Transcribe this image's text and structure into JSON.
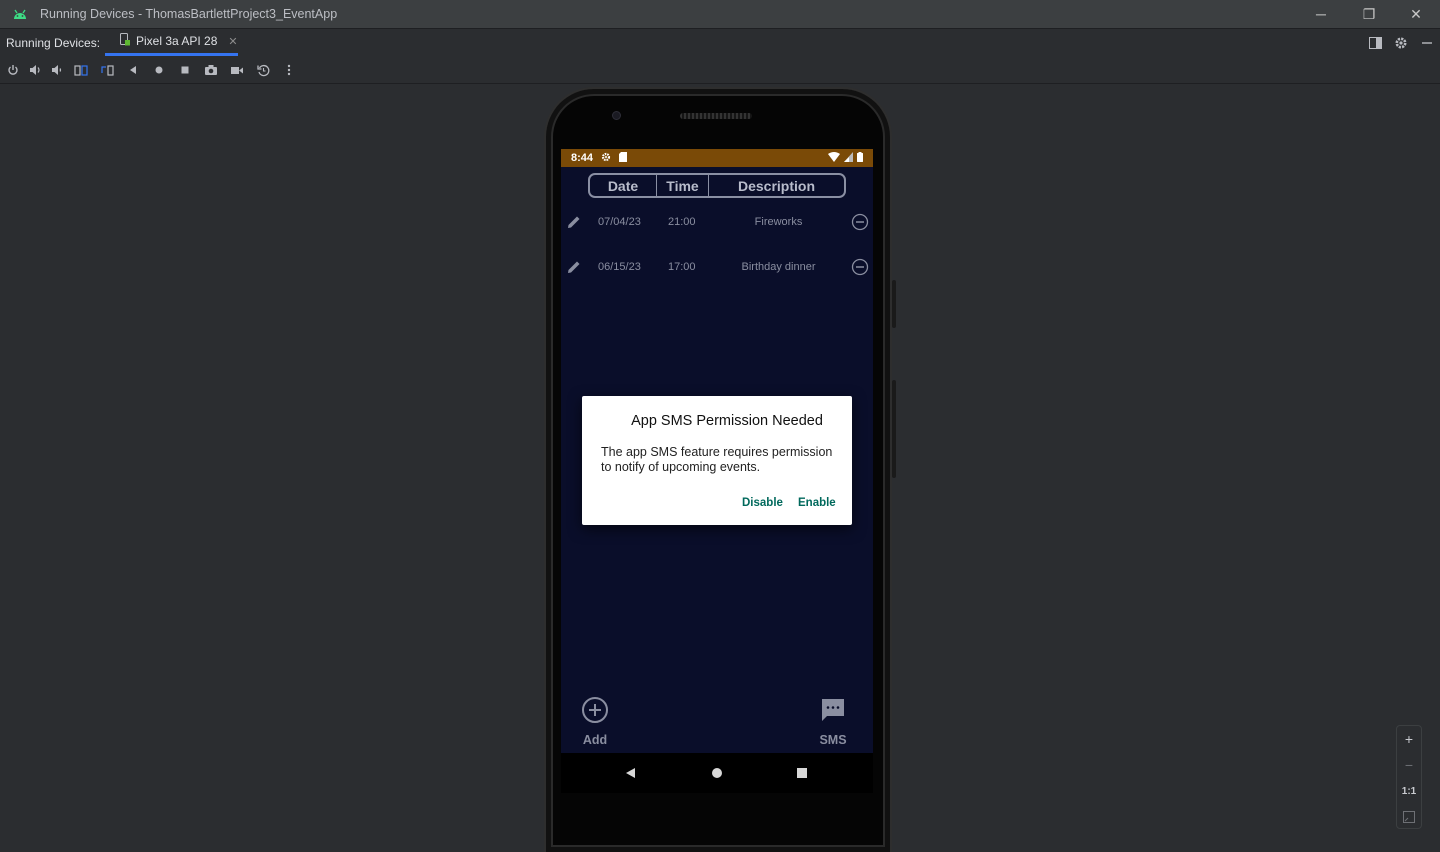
{
  "window": {
    "title": "Running Devices - ThomasBartlettProject3_EventApp",
    "minimize": "─",
    "restore": "❐",
    "close": "✕"
  },
  "tabbar": {
    "label": "Running Devices:",
    "tab_label": "Pixel 3a API 28",
    "tab_close": "✕"
  },
  "toolbar": {
    "buttons": [
      "power-icon",
      "volume-up-icon",
      "volume-down-icon",
      "rotate-left-icon",
      "rotate-right-icon",
      "back-icon",
      "home-icon",
      "overview-icon",
      "screenshot-icon",
      "screen-record-icon",
      "reset-icon",
      "more-icon"
    ]
  },
  "device": {
    "status_time": "8:44",
    "accent_color": "#7a4a07",
    "background_color": "#0a0e2a"
  },
  "table": {
    "headers": [
      "Date",
      "Time",
      "Description"
    ],
    "rows": [
      {
        "date": "07/04/23",
        "time": "21:00",
        "description": "Fireworks"
      },
      {
        "date": "06/15/23",
        "time": "17:00",
        "description": "Birthday dinner"
      }
    ]
  },
  "bottom": {
    "add_label": "Add",
    "sms_label": "SMS"
  },
  "dialog": {
    "title": "App SMS Permission Needed",
    "message": "The app SMS feature requires permission to notify of upcoming events.",
    "disable_label": "Disable",
    "enable_label": "Enable",
    "button_color": "#00695c"
  },
  "zoom": {
    "zoom_in": "+",
    "zoom_out": "−",
    "actual_size": "1:1"
  }
}
